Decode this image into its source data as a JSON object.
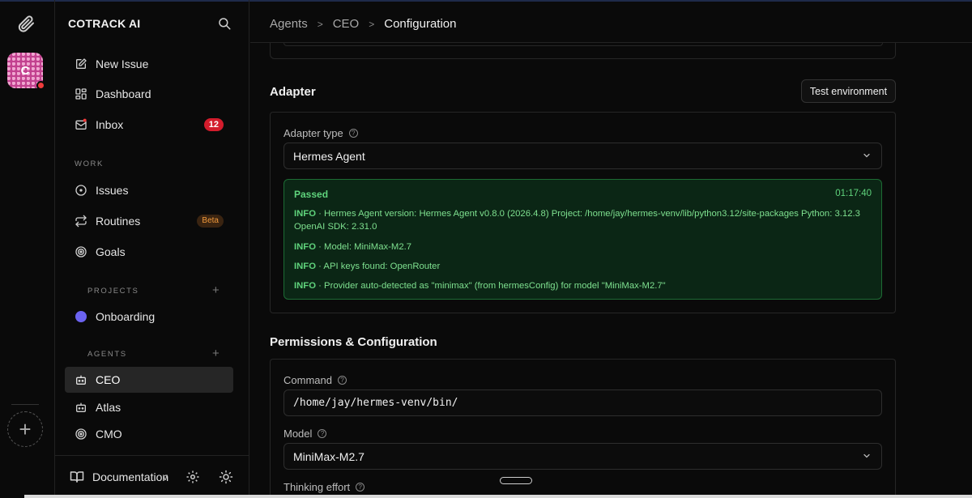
{
  "app": {
    "brand": "COTRACK AI",
    "avatar_letter": "C"
  },
  "sidebar": {
    "top_items": [
      {
        "label": "New Issue",
        "icon": "edit-icon"
      },
      {
        "label": "Dashboard",
        "icon": "dashboard-icon"
      },
      {
        "label": "Inbox",
        "icon": "inbox-icon",
        "badge": "12"
      }
    ],
    "work_title": "WORK",
    "work_items": [
      {
        "label": "Issues",
        "icon": "issue-circle-icon"
      },
      {
        "label": "Routines",
        "icon": "routine-icon",
        "tag": "Beta"
      },
      {
        "label": "Goals",
        "icon": "target-icon"
      }
    ],
    "projects_title": "PROJECTS",
    "projects": [
      {
        "label": "Onboarding",
        "color": "#6b63f0"
      }
    ],
    "agents_title": "AGENTS",
    "agents": [
      {
        "label": "CEO",
        "icon": "bot-icon",
        "active": true
      },
      {
        "label": "Atlas",
        "icon": "bot-icon"
      },
      {
        "label": "CMO",
        "icon": "target-icon"
      }
    ],
    "footer": {
      "documentation": "Documentation",
      "version": "v"
    }
  },
  "breadcrumb": [
    "Agents",
    "CEO",
    "Configuration"
  ],
  "adapter": {
    "title": "Adapter",
    "test_button": "Test environment",
    "type_label": "Adapter type",
    "type_value": "Hermes Agent",
    "result": {
      "status": "Passed",
      "time": "01:17:40",
      "lines": [
        {
          "level": "INFO",
          "text": "Hermes Agent version: Hermes Agent v0.8.0 (2026.4.8) Project: /home/jay/hermes-venv/lib/python3.12/site-packages Python: 3.12.3 OpenAI SDK: 2.31.0"
        },
        {
          "level": "INFO",
          "text": "Model: MiniMax-M2.7"
        },
        {
          "level": "INFO",
          "text": "API keys found: OpenRouter"
        },
        {
          "level": "INFO",
          "text": "Provider auto-detected as \"minimax\" (from hermesConfig) for model \"MiniMax-M2.7\""
        }
      ]
    }
  },
  "permissions": {
    "title": "Permissions & Configuration",
    "command_label": "Command",
    "command_value": "/home/jay/hermes-venv/bin/",
    "model_label": "Model",
    "model_value": "MiniMax-M2.7",
    "thinking_label": "Thinking effort"
  },
  "colors": {
    "badge": "#d31c2c",
    "success": "#5fd37c",
    "project": "#6b63f0"
  }
}
